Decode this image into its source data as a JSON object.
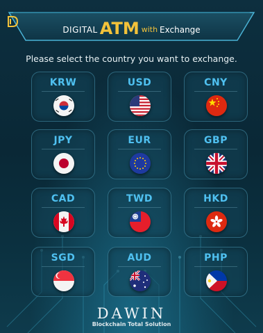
{
  "header": {
    "word1": "DIGITAL",
    "word2": "ATM",
    "word3": "with",
    "word4": "Exchange"
  },
  "prompt": "Please select the country you want to exchange.",
  "currencies": [
    {
      "code": "KRW",
      "flag": "south-korea-flag-icon"
    },
    {
      "code": "USD",
      "flag": "usa-flag-icon"
    },
    {
      "code": "CNY",
      "flag": "china-flag-icon"
    },
    {
      "code": "JPY",
      "flag": "japan-flag-icon"
    },
    {
      "code": "EUR",
      "flag": "eu-flag-icon"
    },
    {
      "code": "GBP",
      "flag": "uk-flag-icon"
    },
    {
      "code": "CAD",
      "flag": "canada-flag-icon"
    },
    {
      "code": "TWD",
      "flag": "taiwan-flag-icon"
    },
    {
      "code": "HKD",
      "flag": "hong-kong-flag-icon"
    },
    {
      "code": "SGD",
      "flag": "singapore-flag-icon"
    },
    {
      "code": "AUD",
      "flag": "australia-flag-icon"
    },
    {
      "code": "PHP",
      "flag": "philippines-flag-icon"
    }
  ],
  "footer": {
    "brand": "DAWIN",
    "tagline": "Blockchain Total Solution"
  },
  "colors": {
    "accent_gold": "#f2c23a",
    "code_blue": "#4fc0f0",
    "background": "#0a2a38"
  }
}
